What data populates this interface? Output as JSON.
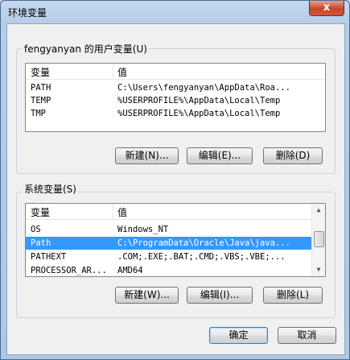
{
  "window": {
    "title": "环境变量",
    "close_symbol": "x"
  },
  "user_vars": {
    "group_label": "fengyanyan 的用户变量(U)",
    "columns": [
      "变量",
      "值"
    ],
    "rows": [
      {
        "name": "PATH",
        "value": "C:\\Users\\fengyanyan\\AppData\\Roa..."
      },
      {
        "name": "TEMP",
        "value": "%USERPROFILE%\\AppData\\Local\\Temp"
      },
      {
        "name": "TMP",
        "value": "%USERPROFILE%\\AppData\\Local\\Temp"
      }
    ],
    "buttons": {
      "new": "新建(N)...",
      "edit": "编辑(E)...",
      "delete": "删除(D)"
    }
  },
  "system_vars": {
    "group_label": "系统变量(S)",
    "columns": [
      "变量",
      "值"
    ],
    "rows": [
      {
        "name": "OS",
        "value": "Windows_NT"
      },
      {
        "name": "Path",
        "value": "C:\\ProgramData\\Oracle\\Java\\java...",
        "selected": true
      },
      {
        "name": "PATHEXT",
        "value": ".COM;.EXE;.BAT;.CMD;.VBS;.VBE;..."
      },
      {
        "name": "PROCESSOR_AR...",
        "value": "AMD64"
      }
    ],
    "buttons": {
      "new": "新建(W)...",
      "edit": "编辑(I)...",
      "delete": "删除(L)"
    }
  },
  "footer": {
    "ok": "确定",
    "cancel": "取消"
  },
  "colors": {
    "selection": "#3399ff",
    "titlebar": "#c4d9ef",
    "close_button": "#c4462c"
  }
}
